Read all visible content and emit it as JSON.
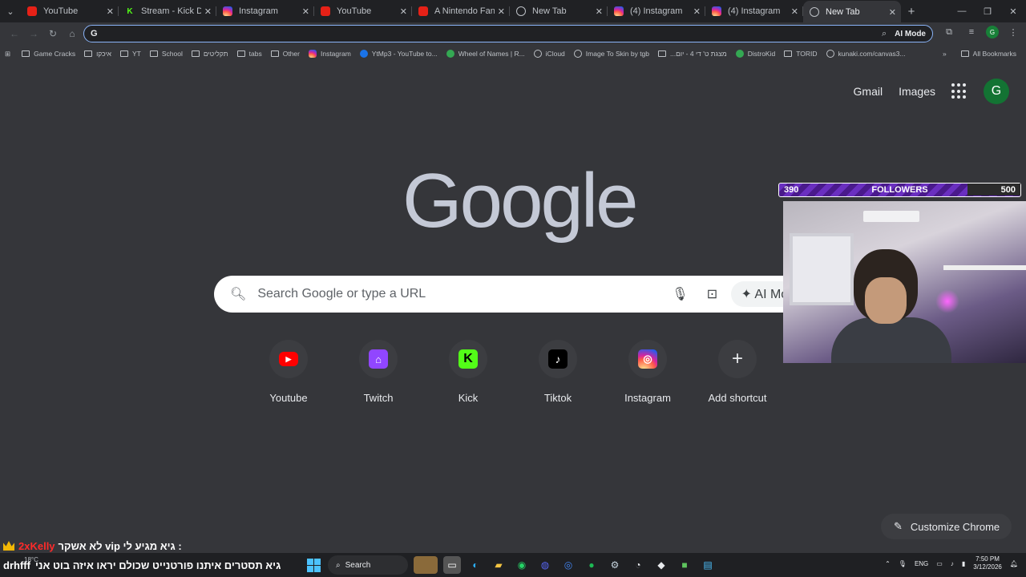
{
  "tabs": [
    {
      "title": "YouTube",
      "icon": "youtube-icon",
      "active": false
    },
    {
      "title": "Stream - Kick Dashbo",
      "icon": "kick-icon",
      "active": false
    },
    {
      "title": "Instagram",
      "icon": "instagram-icon",
      "active": false
    },
    {
      "title": "YouTube",
      "icon": "youtube-icon",
      "active": false
    },
    {
      "title": "A Nintendo Fan's Wo",
      "icon": "youtube-icon",
      "active": false
    },
    {
      "title": "New Tab",
      "icon": "globe-icon",
      "active": false
    },
    {
      "title": "(4) Instagram",
      "icon": "instagram-icon",
      "active": false
    },
    {
      "title": "(4) Instagram",
      "icon": "instagram-icon",
      "active": false
    },
    {
      "title": "New Tab",
      "icon": "globe-icon",
      "active": true
    }
  ],
  "toolbar": {
    "omnibox_value": "",
    "ai_mode_label": "AI Mode"
  },
  "bookmarks": {
    "items": [
      "Game Cracks",
      "איכקו",
      "YT",
      "School",
      "תקליטים",
      "tabs",
      "Other",
      "Instagram",
      "YtMp3 - YouTube to...",
      "Wheel of Names | R...",
      "iCloud",
      "Image To Skin by tgb",
      "...מצגת ט' די 4 - יום",
      "DistroKid",
      "TORID",
      "kunaki.com/canvas3..."
    ],
    "all_bookmarks": "All Bookmarks"
  },
  "header": {
    "gmail": "Gmail",
    "images": "Images",
    "avatar_letter": "G"
  },
  "logo": "Google",
  "search": {
    "placeholder": "Search Google or type a URL",
    "ai_mode": "AI Mode"
  },
  "shortcuts": [
    {
      "label": "Youtube",
      "icon": "youtube-icon",
      "glyph": "▶"
    },
    {
      "label": "Twitch",
      "icon": "twitch-icon",
      "glyph": "⌂"
    },
    {
      "label": "Kick",
      "icon": "kick-icon",
      "glyph": "K"
    },
    {
      "label": "Tiktok",
      "icon": "tiktok-icon",
      "glyph": "♪"
    },
    {
      "label": "Instagram",
      "icon": "instagram-icon",
      "glyph": "◎"
    },
    {
      "label": "Add shortcut",
      "icon": "plus-icon",
      "glyph": "+"
    }
  ],
  "customize": "Customize Chrome",
  "overlay": {
    "followers_current": "390",
    "followers_label": "FOLLOWERS",
    "followers_goal": "500",
    "chat_user": "2xKelly",
    "chat_message": "לא אשקר vip גיא מגיע לי :",
    "chat2_user": "drhfff",
    "chat2_message": "גיא תסטרים איתנו פורטנייט שכולם יראו איזה בוט אני"
  },
  "taskbar": {
    "weather": "18°C",
    "search_label": "Search",
    "lang": "ENG",
    "time": "7:50 PM",
    "date": "3/12/2026"
  },
  "colors": {
    "background": "#35363a",
    "accent": "#8ab4f8"
  }
}
